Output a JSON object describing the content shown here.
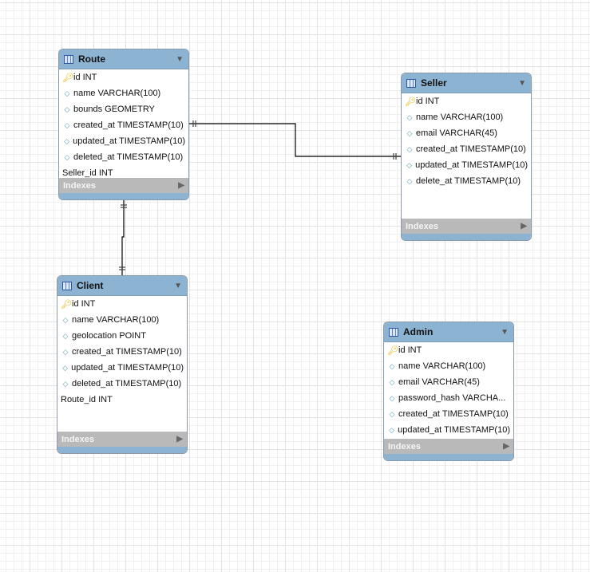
{
  "tables": {
    "route": {
      "name": "Route",
      "columns": [
        "id INT",
        "name VARCHAR(100)",
        "bounds GEOMETRY",
        "created_at TIMESTAMP(10)",
        "updated_at TIMESTAMP(10)",
        "deleted_at TIMESTAMP(10)",
        "Seller_id INT"
      ],
      "kinds": [
        "pk",
        "col",
        "col",
        "col",
        "col",
        "col",
        "fk"
      ]
    },
    "seller": {
      "name": "Seller",
      "columns": [
        "id INT",
        "name VARCHAR(100)",
        "email VARCHAR(45)",
        "created_at TIMESTAMP(10)",
        "updated_at TIMESTAMP(10)",
        "delete_at TIMESTAMP(10)"
      ],
      "kinds": [
        "pk",
        "col",
        "col",
        "col",
        "col",
        "col"
      ]
    },
    "client": {
      "name": "Client",
      "columns": [
        "id INT",
        "name VARCHAR(100)",
        "geolocation POINT",
        "created_at TIMESTAMP(10)",
        "updated_at TIMESTAMP(10)",
        "deleted_at TIMESTAMP(10)",
        "Route_id INT"
      ],
      "kinds": [
        "pk",
        "col",
        "col",
        "col",
        "col",
        "col",
        "fk"
      ]
    },
    "admin": {
      "name": "Admin",
      "columns": [
        "id INT",
        "name VARCHAR(100)",
        "email VARCHAR(45)",
        "password_hash VARCHA...",
        "created_at TIMESTAMP(10)",
        "updated_at TIMESTAMP(10)"
      ],
      "kinds": [
        "pk",
        "col",
        "col",
        "col",
        "col",
        "col"
      ]
    }
  },
  "indexes_label": "Indexes",
  "relationships": [
    {
      "from": "Route",
      "to": "Seller",
      "type": "one-to-one"
    },
    {
      "from": "Client",
      "to": "Route",
      "type": "one-to-one"
    }
  ],
  "colors": {
    "header": "#8db3d2",
    "indexes": "#b9b9b9"
  }
}
